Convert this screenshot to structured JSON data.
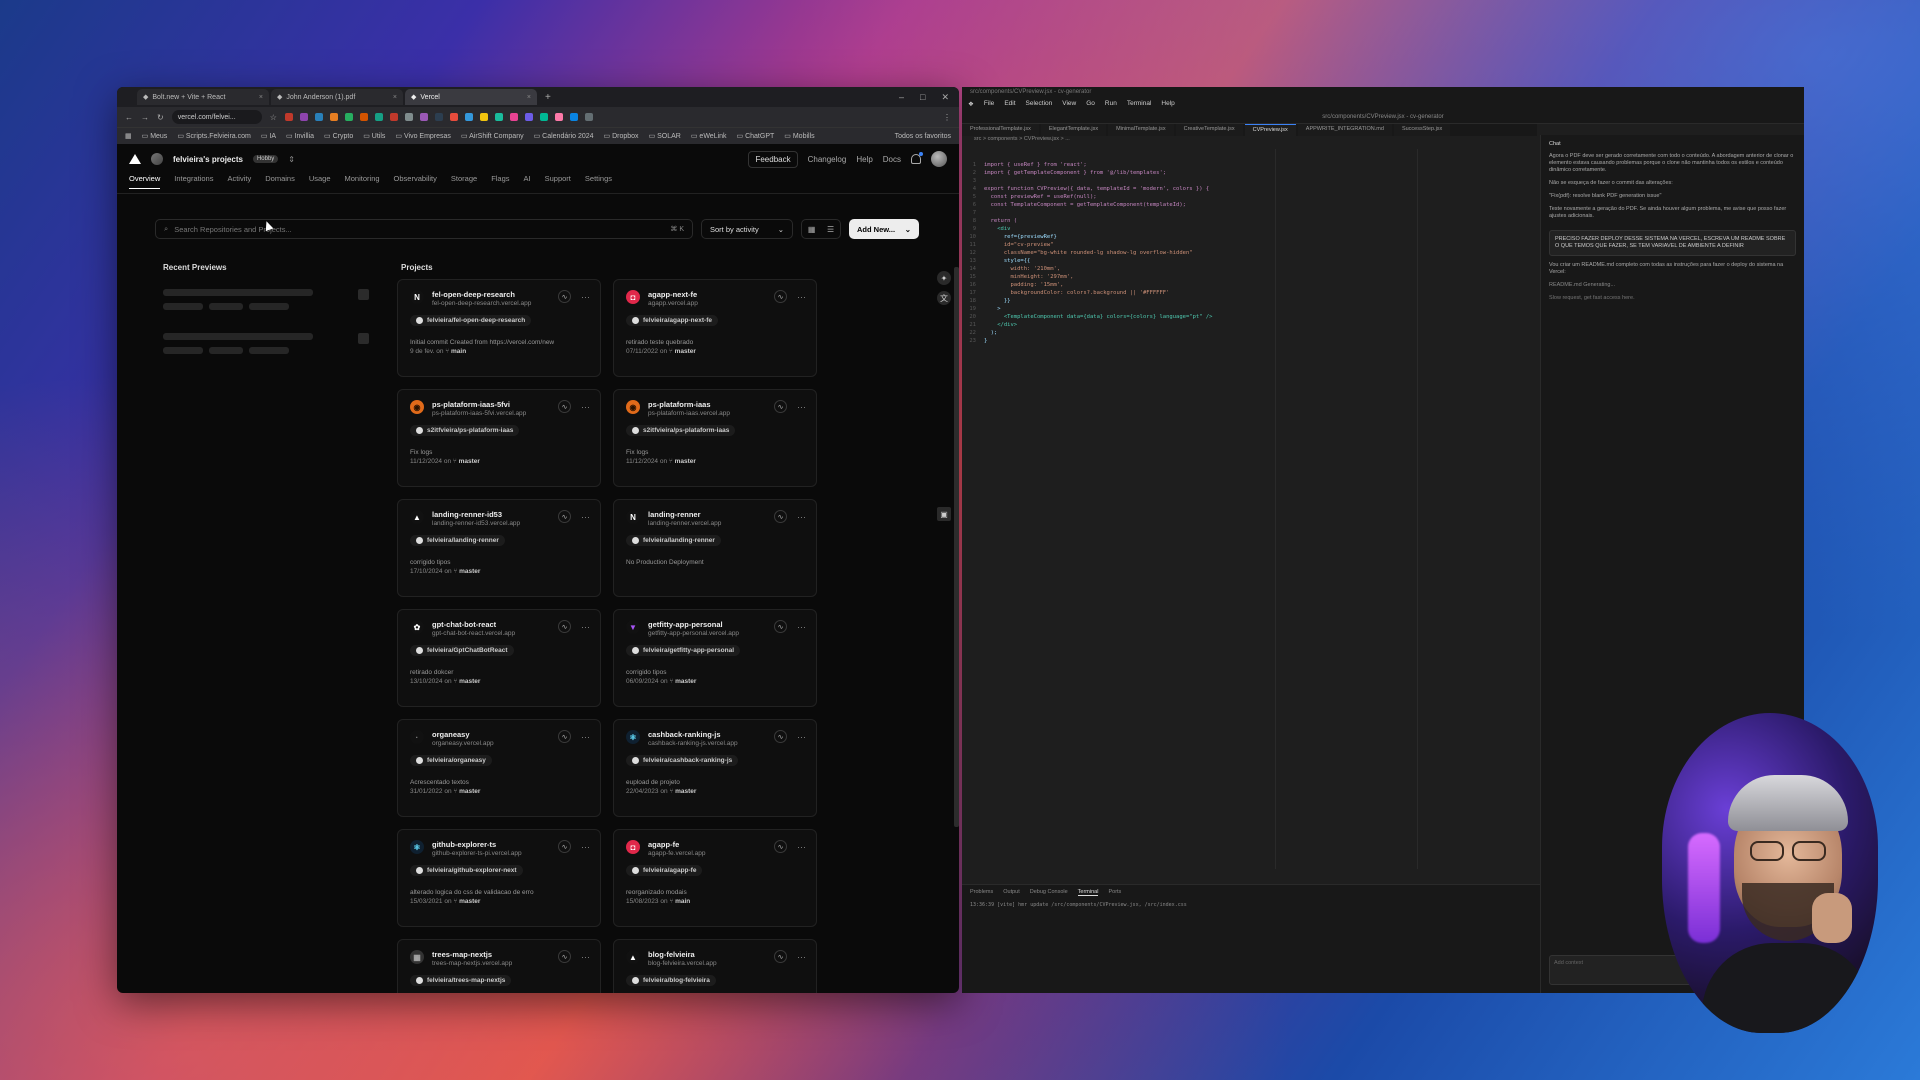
{
  "browser": {
    "tabs": [
      {
        "title": "Bolt.new + Vite + React",
        "active": false
      },
      {
        "title": "John Anderson (1).pdf",
        "active": false
      },
      {
        "title": "Vercel",
        "active": true
      }
    ],
    "url": "vercel.com/felvei...",
    "bookmarks": [
      "Meus",
      "Scripts.Felvieira.com",
      "IA",
      "Invillia",
      "Crypto",
      "Utils",
      "Vivo Empresas",
      "AirShift Company",
      "Calendário 2024",
      "Dropbox",
      "SOLAR",
      "eWeLink",
      "ChatGPT",
      "Mobills"
    ],
    "bookmarks_right": "Todos os favoritos"
  },
  "vercel": {
    "team_name": "felvieira's projects",
    "plan_badge": "Hobby",
    "top_links": {
      "feedback": "Feedback",
      "changelog": "Changelog",
      "help": "Help",
      "docs": "Docs"
    },
    "nav": [
      "Overview",
      "Integrations",
      "Activity",
      "Domains",
      "Usage",
      "Monitoring",
      "Observability",
      "Storage",
      "Flags",
      "AI",
      "Support",
      "Settings"
    ],
    "search_placeholder": "Search Repositories and Projects...",
    "search_kbd": "K",
    "sort_label": "Sort by activity",
    "add_new_label": "Add New...",
    "recent_previews_title": "Recent Previews",
    "projects_title": "Projects",
    "projects": [
      {
        "name": "fel-open-deep-research",
        "url": "fel-open-deep-research.vercel.app",
        "repo": "felvieira/fel-open-deep-research",
        "commit": "Initial commit Created from https://vercel.com/new",
        "date": "9 de fev.",
        "branch": "main",
        "icon": "N",
        "icon_bg": "#111111",
        "icon_fg": "#ffffff"
      },
      {
        "name": "agapp-next-fe",
        "url": "agapp.vercel.app",
        "repo": "felvieira/agapp-next-fe",
        "commit": "retirado teste quebrado",
        "date": "07/11/2022",
        "branch": "master",
        "icon": "◘",
        "icon_bg": "#e0284a",
        "icon_fg": "#ffffff"
      },
      {
        "name": "ps-plataform-iaas-5fvi",
        "url": "ps-plataform-iaas-5fvi.vercel.app",
        "repo": "s2itfvieira/ps-plataform-iaas",
        "commit": "Fix logs",
        "date": "11/12/2024",
        "branch": "master",
        "icon": "◉",
        "icon_bg": "#e06a1a",
        "icon_fg": "#2a1200"
      },
      {
        "name": "ps-plataform-iaas",
        "url": "ps-plataform-iaas.vercel.app",
        "repo": "s2itfvieira/ps-plataform-iaas",
        "commit": "Fix logs",
        "date": "11/12/2024",
        "branch": "master",
        "icon": "◉",
        "icon_bg": "#e06a1a",
        "icon_fg": "#2a1200"
      },
      {
        "name": "landing-renner-id53",
        "url": "landing-renner-id53.vercel.app",
        "repo": "felvieira/landing-renner",
        "commit": "corrigido tipos",
        "date": "17/10/2024",
        "branch": "master",
        "icon": "▲",
        "icon_bg": "#111111",
        "icon_fg": "#ffffff"
      },
      {
        "name": "landing-renner",
        "url": "landing-renner.vercel.app",
        "repo": "felvieira/landing-renner",
        "commit": "No Production Deployment",
        "date": "",
        "branch": "",
        "icon": "N",
        "icon_bg": "#111111",
        "icon_fg": "#ffffff"
      },
      {
        "name": "gpt-chat-bot-react",
        "url": "gpt-chat-bot-react.vercel.app",
        "repo": "felvieira/GptChatBotReact",
        "commit": "retirado dokcer",
        "date": "13/10/2024",
        "branch": "master",
        "icon": "✿",
        "icon_bg": "#111111",
        "icon_fg": "#ffffff"
      },
      {
        "name": "getfitty-app-personal",
        "url": "getfitty-app-personal.vercel.app",
        "repo": "felvieira/getfitty-app-personal",
        "commit": "corrigido tipos",
        "date": "06/09/2024",
        "branch": "master",
        "icon": "▼",
        "icon_bg": "#111111",
        "icon_fg": "#a855f7"
      },
      {
        "name": "organeasy",
        "url": "organeasy.vercel.app",
        "repo": "felvieira/organeasy",
        "commit": "Acrescentado textos",
        "date": "31/01/2022",
        "branch": "master",
        "icon": "·",
        "icon_bg": "#111111",
        "icon_fg": "#888888"
      },
      {
        "name": "cashback-ranking-js",
        "url": "cashback-ranking-js.vercel.app",
        "repo": "felvieira/cashback-ranking-js",
        "commit": "eupload de projeto",
        "date": "22/04/2023",
        "branch": "master",
        "icon": "⚛",
        "icon_bg": "#0f2030",
        "icon_fg": "#61dafb"
      },
      {
        "name": "github-explorer-ts",
        "url": "github-explorer-ts-pi.vercel.app",
        "repo": "felvieira/github-explorer-next",
        "commit": "alterado logica do css de validacao de erro",
        "date": "15/03/2021",
        "branch": "master",
        "icon": "⚛",
        "icon_bg": "#0f2030",
        "icon_fg": "#61dafb"
      },
      {
        "name": "agapp-fe",
        "url": "agapp-fe.vercel.app",
        "repo": "felvieira/agapp-fe",
        "commit": "reorganizado modais",
        "date": "15/08/2023",
        "branch": "main",
        "icon": "◘",
        "icon_bg": "#e0284a",
        "icon_fg": "#ffffff"
      },
      {
        "name": "trees-map-nextjs",
        "url": "trees-map-nextjs.vercel.app",
        "repo": "felvieira/trees-map-nextjs",
        "commit": "",
        "date": "",
        "branch": "",
        "icon": "▦",
        "icon_bg": "#333333",
        "icon_fg": "#aaaaaa"
      },
      {
        "name": "blog-felvieira",
        "url": "blog-felvieira.vercel.app",
        "repo": "felvieira/blog-felvieira",
        "commit": "",
        "date": "",
        "branch": "",
        "icon": "▲",
        "icon_bg": "#111111",
        "icon_fg": "#ffffff"
      }
    ]
  },
  "editor": {
    "title": "src/components/CVPreview.jsx - cv-generator",
    "menu": [
      "File",
      "Edit",
      "Selection",
      "View",
      "Go",
      "Run",
      "Terminal",
      "Help"
    ],
    "command_center": "src/components/CVPreview.jsx - cv-generator",
    "tabs": [
      "ProfessionalTemplate.jsx",
      "ElegantTemplate.jsx",
      "MinimalTemplate.jsx",
      "CreativeTemplate.jsx",
      "CVPreview.jsx",
      "APPWRITE_INTEGRATION.md",
      "SuccessStep.jsx"
    ],
    "active_tab": "CVPreview.jsx",
    "breadcrumb": "src > components > CVPreview.jsx > ...",
    "code": [
      "import { useRef } from 'react';",
      "import { getTemplateComponent } from '@/lib/templates';",
      "",
      "export function CVPreview({ data, templateId = 'modern', colors }) {",
      "  const previewRef = useRef(null);",
      "  const TemplateComponent = getTemplateComponent(templateId);",
      "",
      "  return (",
      "    <div",
      "      ref={previewRef}",
      "      id=\"cv-preview\"",
      "      className=\"bg-white rounded-lg shadow-lg overflow-hidden\"",
      "      style={{",
      "        width: '210mm',",
      "        minHeight: '297mm',",
      "        padding: '15mm',",
      "        backgroundColor: colors?.background || '#FFFFFF'",
      "      }}",
      "    >",
      "      <TemplateComponent data={data} colors={colors} language=\"pt\" />",
      "    </div>",
      "  );",
      "}"
    ],
    "chat": {
      "title": "Chat",
      "messages": [
        "Agora o PDF deve ser gerado corretamente com todo o conteúdo. A abordagem anterior de clonar o elemento estava causando problemas porque o clone não mantinha todos os estilos e conteúdo dinâmico corretamente.",
        "Não se esqueça de fazer o commit das alterações:",
        "\"Fix(pdf): resolve blank PDF generation issue\"",
        "Teste novamente a geração do PDF. Se ainda houver algum problema, me avise que posso fazer ajustes adicionais."
      ],
      "user_prompt": "PRECISO FAZER DEPLOY DESSE SISTEMA NA VERCEL, ESCREVA UM README SOBRE O QUE TEMOS QUE FAZER, SE TEM VARIAVEL DE AMBIENTE A DEFINIR",
      "reply": "Vou criar um README.md completo com todas as instruções para fazer o deploy do sistema na Vercel:",
      "file_chip": "README.md Generating...",
      "status": "Slow request, get fast access here.",
      "input_placeholder": "Add context"
    },
    "terminal_tabs": [
      "Problems",
      "Output",
      "Debug Console",
      "Terminal",
      "Ports"
    ],
    "terminal_active": "Terminal",
    "terminal_line": "13:36:39 [vite] hmr update /src/components/CVPreview.jsx, /src/index.css"
  }
}
